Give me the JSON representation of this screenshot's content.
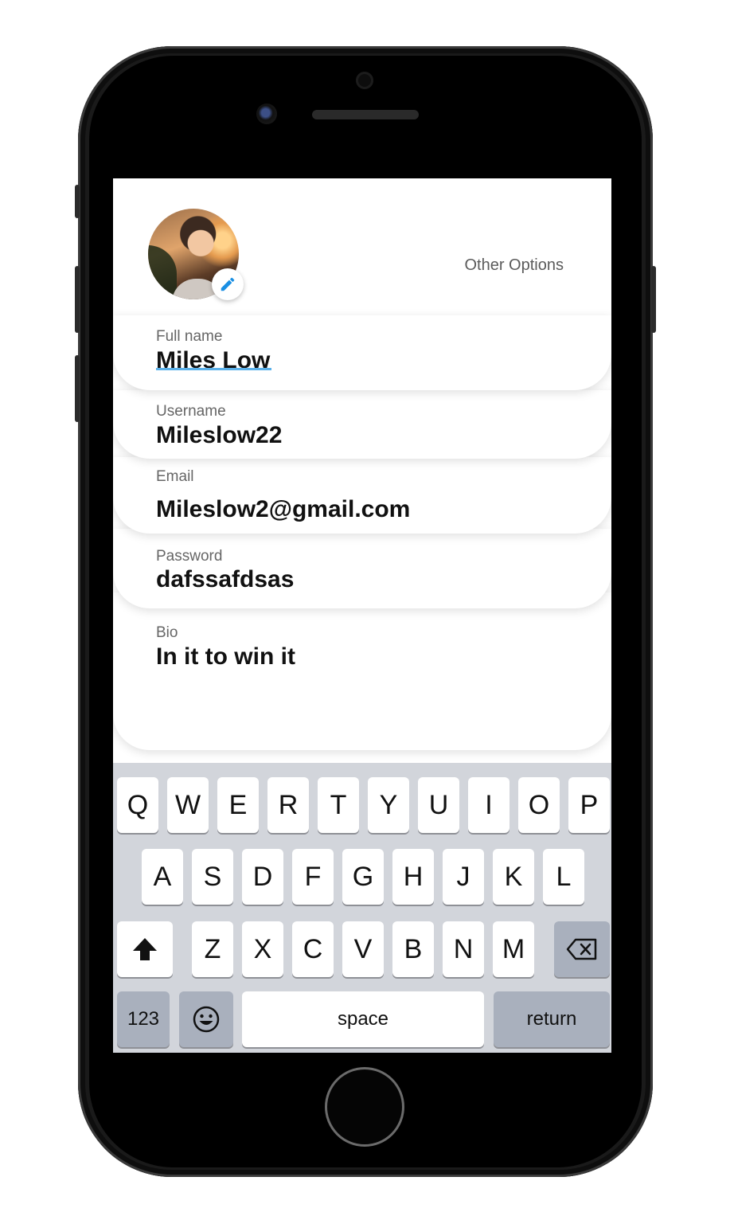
{
  "header": {
    "other_options": "Other Options"
  },
  "fields": [
    {
      "label": "Full name",
      "value": "Miles Low"
    },
    {
      "label": "Username",
      "value": "Mileslow22"
    },
    {
      "label": "Email",
      "value": "Mileslow2@gmail.com"
    },
    {
      "label": "Password",
      "value": "dafssafdsas"
    },
    {
      "label": "Bio",
      "value": "In it to win it"
    }
  ],
  "keyboard": {
    "row1": [
      "Q",
      "W",
      "E",
      "R",
      "T",
      "Y",
      "U",
      "I",
      "O",
      "P"
    ],
    "row2": [
      "A",
      "S",
      "D",
      "F",
      "G",
      "H",
      "J",
      "K",
      "L"
    ],
    "row3": [
      "Z",
      "X",
      "C",
      "V",
      "B",
      "N",
      "M"
    ],
    "numbers_label": "123",
    "space_label": "space",
    "return_label": "return"
  },
  "icons": [
    "pencil-icon",
    "shift-icon",
    "backspace-icon",
    "emoji-icon"
  ],
  "colors": {
    "accent": "#1a8fe3",
    "underline": "#5bb1ea",
    "keyboard_bg": "#d2d5db"
  }
}
